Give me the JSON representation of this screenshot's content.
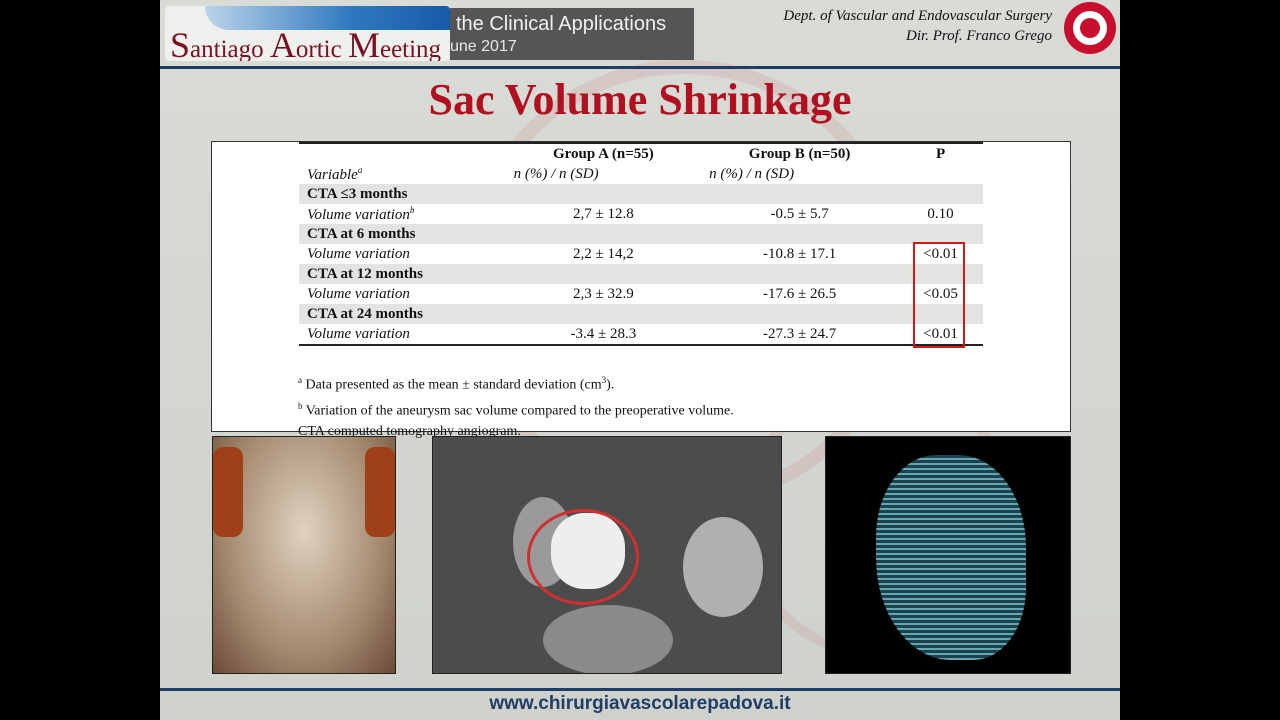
{
  "header": {
    "meeting_initial_s": "S",
    "meeting_s_rest": "antiago ",
    "meeting_initial_a": "A",
    "meeting_a_rest": "ortic ",
    "meeting_initial_m": "M",
    "meeting_m_rest": "eeting",
    "conference_line1": "the Clinical Applications",
    "conference_line2": "une 2017",
    "dept_line1": "Dept. of Vascular and Endovascular Surgery",
    "dept_line2": "Dir. Prof. Franco Grego"
  },
  "title": "Sac Volume Shrinkage",
  "table": {
    "col_headers": [
      "Group A (n=55)",
      "Group B (n=50)",
      "P"
    ],
    "col_subheaders": [
      "n (%) / n (SD)",
      "n (%) / n (SD)"
    ],
    "variable_label": "Variable",
    "variable_sup": "a",
    "groups": [
      {
        "label": "CTA ≤3 months",
        "row_label": "Volume variation",
        "row_sup": "b",
        "a": "2,7 ± 12.8",
        "b": "-0.5 ± 5.7",
        "p": "0.10"
      },
      {
        "label": "CTA at 6 months",
        "row_label": "Volume variation",
        "row_sup": "",
        "a": "2,2 ± 14,2",
        "b": "-10.8 ± 17.1",
        "p": "<0.01"
      },
      {
        "label": "CTA at 12 months",
        "row_label": "Volume variation",
        "row_sup": "",
        "a": "2,3 ± 32.9",
        "b": "-17.6 ± 26.5",
        "p": "<0.05"
      },
      {
        "label": "CTA at 24 months",
        "row_label": "Volume variation",
        "row_sup": "",
        "a": "-3.4 ± 28.3",
        "b": "-27.3 ± 24.7",
        "p": "<0.01"
      }
    ]
  },
  "notes": {
    "a_sup": "a",
    "a_text": "Data presented as the mean ± standard deviation (cm",
    "a_unit_sup": "3",
    "a_end": ").",
    "b_sup": "b",
    "b_text": "Variation of the  aneurysm sac volume compared to the preoperative volume.",
    "c_text": "CTA computed tomography angiogram."
  },
  "footer": {
    "url": "www.chirurgiavascolarepadova.it"
  }
}
